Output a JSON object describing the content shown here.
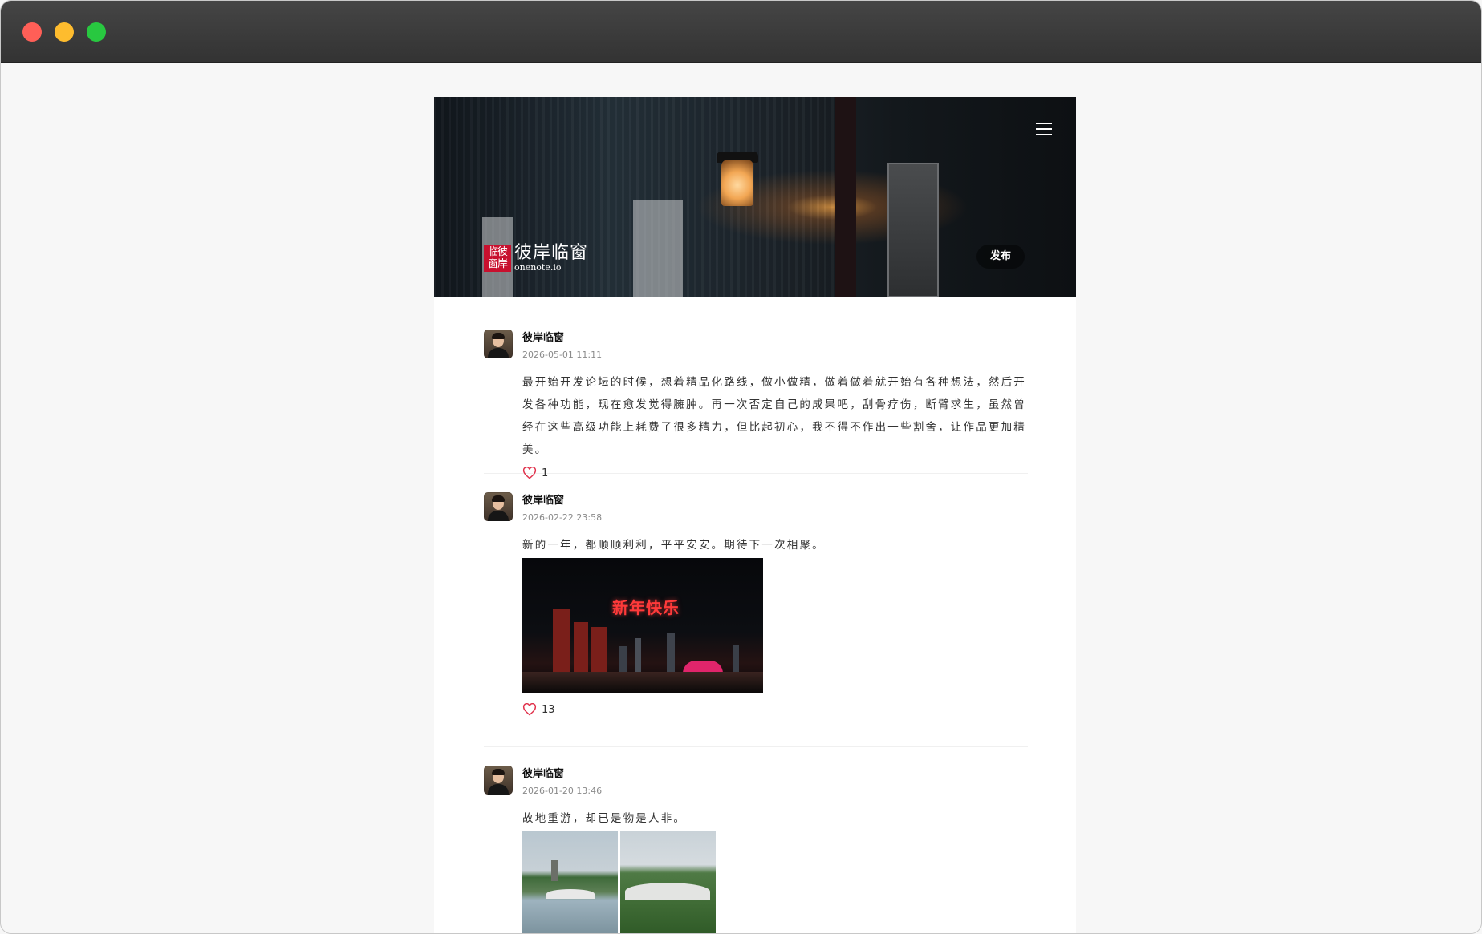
{
  "header": {
    "logo_seal": "临彼窗岸",
    "logo_name": "彼岸临窗",
    "logo_domain": "onenote.io",
    "publish_label": "发布"
  },
  "posts": [
    {
      "author": "彼岸临窗",
      "time": "2026-05-01 11:11",
      "content": "最开始开发论坛的时候，想着精品化路线，做小做精，做着做着就开始有各种想法，然后开发各种功能，现在愈发觉得臃肿。再一次否定自己的成果吧，刮骨疗伤，断臂求生，虽然曾经在这些高级功能上耗费了很多精力，但比起初心，我不得不作出一些割舍，让作品更加精美。",
      "likes": "1"
    },
    {
      "author": "彼岸临窗",
      "time": "2026-02-22 23:58",
      "content": "新的一年，都顺顺利利，平平安安。期待下一次相聚。",
      "image_caption": "新年快乐",
      "likes": "13"
    },
    {
      "author": "彼岸临窗",
      "time": "2026-01-20 13:46",
      "content": "故地重游，却已是物是人非。"
    }
  ],
  "colors": {
    "accent_red": "#c8102e",
    "heart": "#e0304a"
  }
}
